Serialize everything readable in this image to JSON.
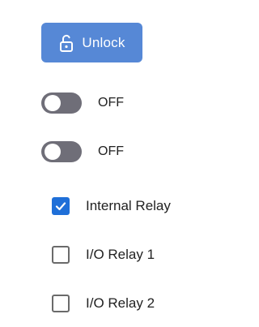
{
  "unlock_button": {
    "label": "Unlock",
    "icon": "unlock-icon",
    "color": "#5688d6"
  },
  "toggles": [
    {
      "state": "OFF",
      "on": false
    },
    {
      "state": "OFF",
      "on": false
    }
  ],
  "checkboxes": [
    {
      "label": "Internal Relay",
      "checked": true
    },
    {
      "label": "I/O Relay 1",
      "checked": false
    },
    {
      "label": "I/O Relay 2",
      "checked": false
    }
  ],
  "colors": {
    "accent": "#1f6fd8",
    "toggle_off": "#6f6e78"
  }
}
